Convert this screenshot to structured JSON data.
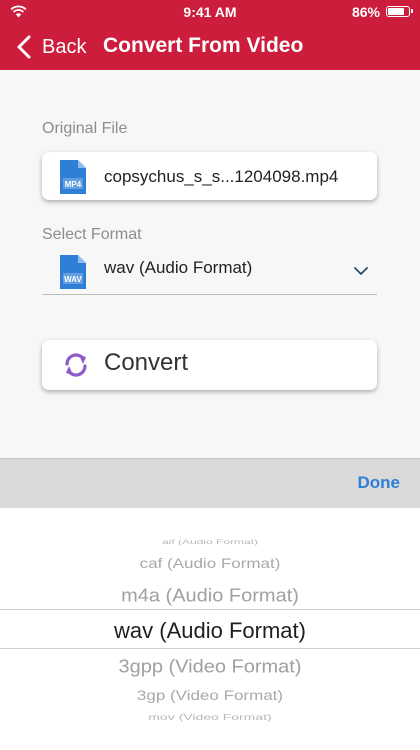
{
  "status_bar": {
    "time": "9:41 AM",
    "battery_text": "86%",
    "battery_level": 0.86
  },
  "nav": {
    "back_label": "Back",
    "title": "Convert From Video"
  },
  "original_file": {
    "label": "Original File",
    "icon_text": "MP4",
    "file_name": "copsychus_s_s...1204098.mp4"
  },
  "select_format": {
    "label": "Select Format",
    "icon_text": "WAV",
    "value": "wav (Audio Format)"
  },
  "convert_button": {
    "label": "Convert"
  },
  "toolbar": {
    "done_label": "Done"
  },
  "picker": {
    "items": [
      "aif (Audio Format)",
      "caf (Audio Format)",
      "m4a (Audio Format)",
      "wav (Audio Format)",
      "3gpp (Video Format)",
      "3gp (Video Format)",
      "mov (Video Format)"
    ],
    "selected_index": 3
  },
  "colors": {
    "accent": "#cc1d3d",
    "done": "#2f7fd6",
    "file_icon": "#2f7fd6",
    "convert_icon": "#8e5bc7"
  }
}
